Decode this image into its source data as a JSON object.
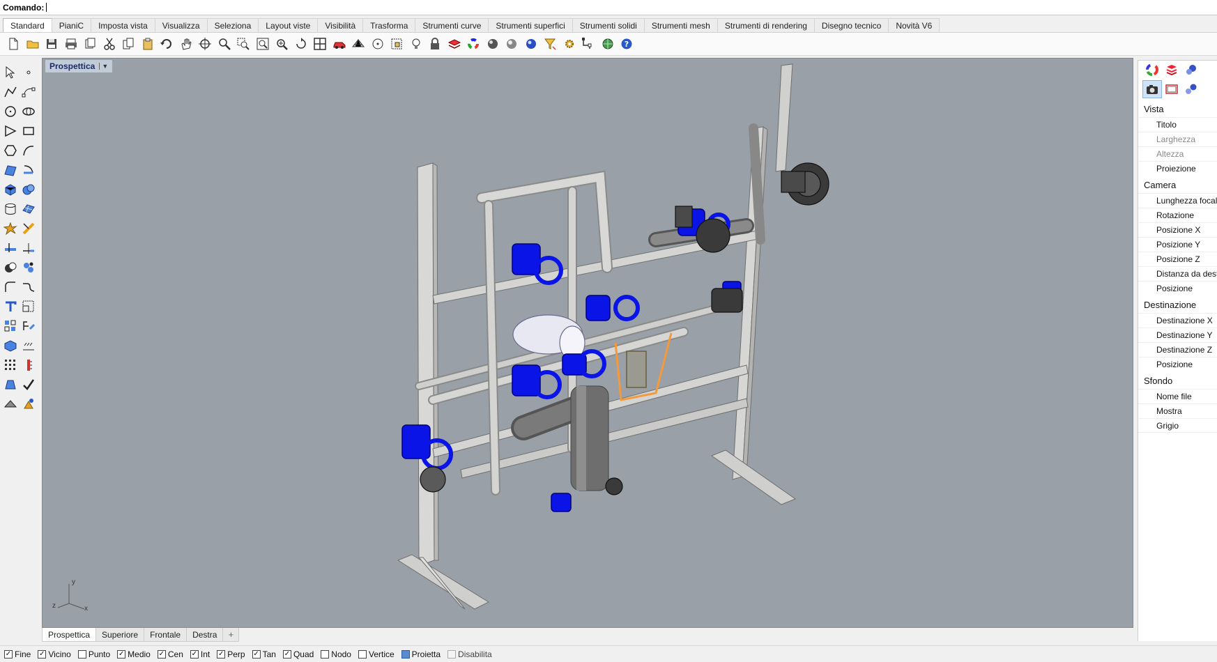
{
  "command": {
    "label": "Comando:"
  },
  "menu_tabs": [
    {
      "label": "Standard",
      "active": true
    },
    {
      "label": "PianiC"
    },
    {
      "label": "Imposta vista"
    },
    {
      "label": "Visualizza"
    },
    {
      "label": "Seleziona"
    },
    {
      "label": "Layout viste"
    },
    {
      "label": "Visibilità"
    },
    {
      "label": "Trasforma"
    },
    {
      "label": "Strumenti curve"
    },
    {
      "label": "Strumenti superfici"
    },
    {
      "label": "Strumenti solidi"
    },
    {
      "label": "Strumenti mesh"
    },
    {
      "label": "Strumenti di rendering"
    },
    {
      "label": "Disegno tecnico"
    },
    {
      "label": "Novità V6"
    }
  ],
  "toolbar_icons": [
    "new-file-icon",
    "open-folder-icon",
    "save-icon",
    "print-icon",
    "copy-paste-icon",
    "cut-icon",
    "copy-icon",
    "clipboard-icon",
    "undo-icon",
    "pan-hand-icon",
    "rotate-view-icon",
    "zoom-icon",
    "zoom-window-icon",
    "zoom-extents-icon",
    "zoom-selected-icon",
    "undo-view-icon",
    "four-viewports-icon",
    "car-icon",
    "mesh-object-icon",
    "circle-point-icon",
    "dimension-icon",
    "light-bulb-icon",
    "lock-icon",
    "layer-icon",
    "color-wheel-icon",
    "render-sphere-icon",
    "material-sphere-icon",
    "environment-sphere-icon",
    "filter-funnel-icon",
    "settings-gear-icon",
    "snap-icon",
    "globe-icon",
    "help-icon"
  ],
  "left_toolbar": [
    [
      "select-arrow-icon",
      "point-icon"
    ],
    [
      "polyline-icon",
      "curve-points-icon"
    ],
    [
      "circle-icon",
      "ellipse-icon"
    ],
    [
      "polygon-icon",
      "rectangle-icon"
    ],
    [
      "polygon-center-icon",
      "arc-icon"
    ],
    [
      "surface-point-icon",
      "revolve-icon"
    ],
    [
      "box-icon",
      "sphere-union-icon"
    ],
    [
      "cylinder-icon",
      "mesh-plane-icon"
    ],
    [
      "explode-icon",
      "trim-icon"
    ],
    [
      "split-icon",
      "extend-icon"
    ],
    [
      "boolean-icon",
      "group-icon"
    ],
    [
      "fillet-icon",
      "blend-icon"
    ],
    [
      "text-icon",
      "scale-icon"
    ],
    [
      "array-icon",
      "dimension-tool-icon"
    ],
    [
      "block-icon",
      "hatch-icon"
    ],
    [
      "grid-array-icon",
      "ruler-icon"
    ],
    [
      "analyze-icon",
      "check-icon"
    ],
    [
      "shade-icon",
      "render-tool-icon"
    ]
  ],
  "viewport": {
    "title": "Prospettica"
  },
  "axes": {
    "x": "x",
    "y": "y",
    "z": "z"
  },
  "viewport_tabs": [
    {
      "label": "Prospettica",
      "active": true
    },
    {
      "label": "Superiore"
    },
    {
      "label": "Frontale"
    },
    {
      "label": "Destra"
    }
  ],
  "add_tab": "+",
  "snaps": [
    {
      "label": "Fine",
      "checked": true
    },
    {
      "label": "Vicino",
      "checked": true
    },
    {
      "label": "Punto",
      "checked": false
    },
    {
      "label": "Medio",
      "checked": true
    },
    {
      "label": "Cen",
      "checked": true
    },
    {
      "label": "Int",
      "checked": true
    },
    {
      "label": "Perp",
      "checked": true
    },
    {
      "label": "Tan",
      "checked": true
    },
    {
      "label": "Quad",
      "checked": true
    },
    {
      "label": "Nodo",
      "checked": false
    },
    {
      "label": "Vertice",
      "checked": false
    },
    {
      "label": "Proietta",
      "checked": "filled"
    },
    {
      "label": "Disabilita",
      "checked": "disabled"
    }
  ],
  "panel": {
    "sections": [
      {
        "title": "Vista",
        "rows": [
          {
            "label": "Titolo"
          },
          {
            "label": "Larghezza",
            "disabled": true
          },
          {
            "label": "Altezza",
            "disabled": true
          },
          {
            "label": "Proiezione"
          }
        ]
      },
      {
        "title": "Camera",
        "rows": [
          {
            "label": "Lunghezza focale"
          },
          {
            "label": "Rotazione"
          },
          {
            "label": "Posizione X"
          },
          {
            "label": "Posizione Y"
          },
          {
            "label": "Posizione Z"
          },
          {
            "label": "Distanza da destinazione"
          },
          {
            "label": "Posizione"
          }
        ]
      },
      {
        "title": "Destinazione",
        "rows": [
          {
            "label": "Destinazione X"
          },
          {
            "label": "Destinazione Y"
          },
          {
            "label": "Destinazione Z"
          },
          {
            "label": "Posizione"
          }
        ]
      },
      {
        "title": "Sfondo",
        "rows": [
          {
            "label": "Nome file"
          },
          {
            "label": "Mostra"
          },
          {
            "label": "Grigio"
          }
        ]
      }
    ]
  },
  "colors": {
    "viewport_bg": "#99a0a8",
    "valve_blue": "#0a14e6",
    "pipe": "#d2d2d0",
    "bracket_orange": "#f29a3c"
  }
}
